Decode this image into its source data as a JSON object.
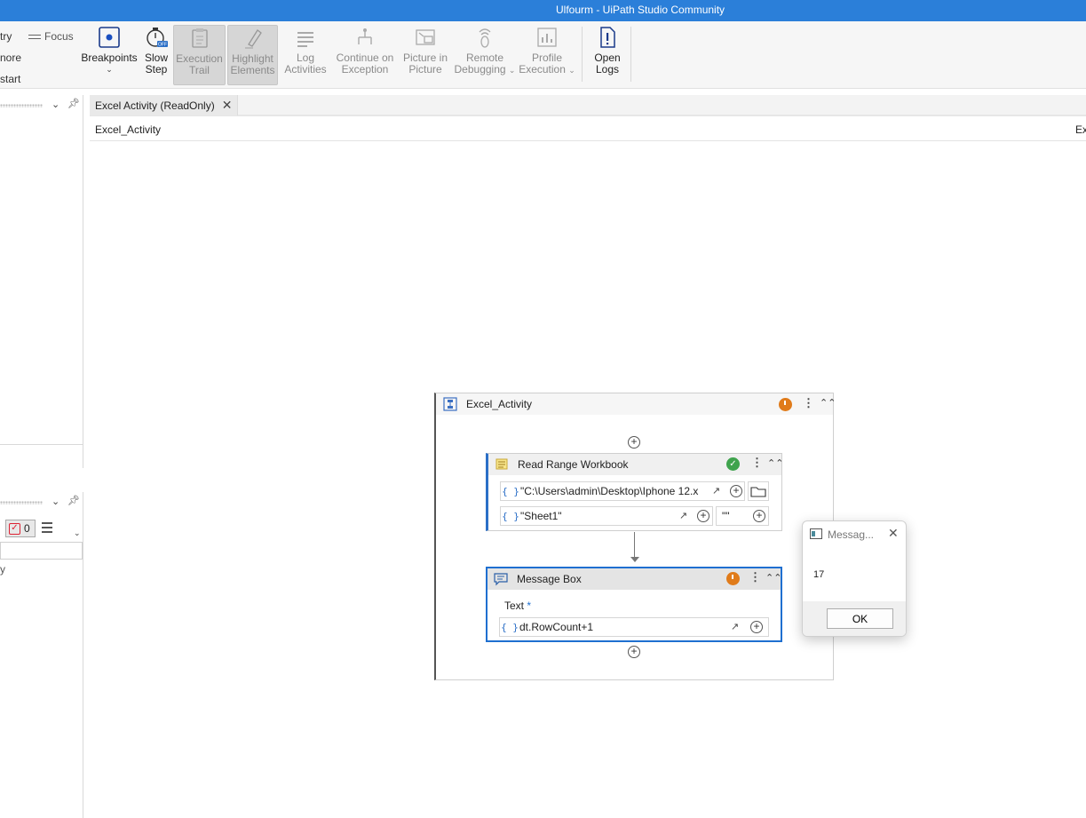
{
  "window": {
    "title": "Ulfourm - UiPath Studio Community"
  },
  "ribbon": {
    "left_cut": {
      "try": "try",
      "focus": "Focus",
      "more": "nore",
      "start": "start"
    },
    "buttons": {
      "breakpoints": "Breakpoints",
      "slow_step_1": "Slow",
      "slow_step_2": "Step",
      "slow_step_badge": "OFF",
      "execution_trail_1": "Execution",
      "execution_trail_2": "Trail",
      "highlight_1": "Highlight",
      "highlight_2": "Elements",
      "log_1": "Log",
      "log_2": "Activities",
      "continue_1": "Continue on",
      "continue_2": "Exception",
      "pip_1": "Picture in",
      "pip_2": "Picture",
      "remote_1": "Remote",
      "remote_2": "Debugging",
      "profile_1": "Profile",
      "profile_2": "Execution",
      "open_logs_1": "Open",
      "open_logs_2": "Logs"
    }
  },
  "left_panel": {
    "error_count": "0",
    "cut_text": "y"
  },
  "tabs": {
    "active": "Excel Activity (ReadOnly)"
  },
  "breadcrumb": {
    "path": "Excel_Activity",
    "right_cut": "Ex"
  },
  "workflow": {
    "sequence_title": "Excel_Activity",
    "read_range": {
      "title": "Read Range Workbook",
      "path_value": "\"C:\\Users\\admin\\Desktop\\Iphone 12.x",
      "sheet_value": "\"Sheet1\"",
      "range_value": "\"\""
    },
    "message_box": {
      "title": "Message Box",
      "text_label": "Text",
      "required_mark": "*",
      "text_value": "dt.RowCount+1"
    }
  },
  "dialog": {
    "title": "Messag...",
    "message": "17",
    "ok": "OK"
  },
  "colors": {
    "titlebar": "#2b7fd9",
    "accent_blue": "#1f6fd0",
    "clock_orange": "#e07b1a",
    "check_green": "#3fa34d"
  }
}
